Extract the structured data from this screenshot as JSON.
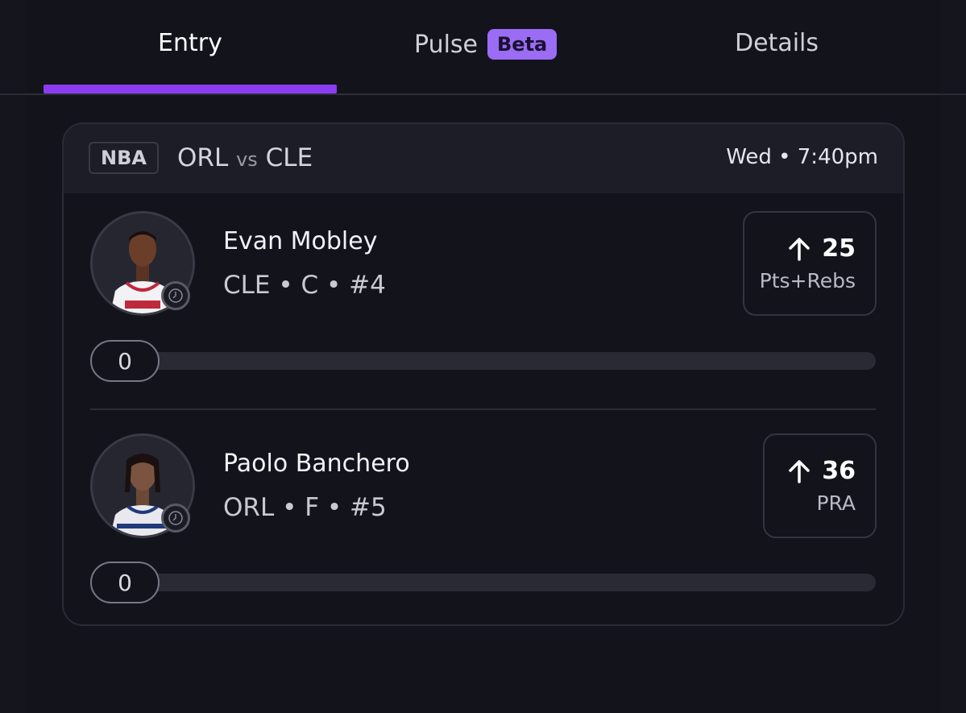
{
  "tabs": [
    {
      "label": "Entry"
    },
    {
      "label": "Pulse",
      "badge": "Beta"
    },
    {
      "label": "Details"
    }
  ],
  "game": {
    "league": "NBA",
    "home": "ORL",
    "vs": "vs",
    "away": "CLE",
    "time": "Wed • 7:40pm"
  },
  "players": [
    {
      "name": "Evan Mobley",
      "info": "CLE • C • #4",
      "line": "25",
      "stat": "Pts+Rebs",
      "progress": "0",
      "jersey_color": "#f2f2f4",
      "jersey_accent": "#c0283c"
    },
    {
      "name": "Paolo Banchero",
      "info": "ORL • F • #5",
      "line": "36",
      "stat": "PRA",
      "progress": "0",
      "jersey_color": "#e8e8ee",
      "jersey_accent": "#1e3a7a"
    }
  ],
  "colors": {
    "accent": "#8b3cf2",
    "badge": "#9b6cf4"
  }
}
